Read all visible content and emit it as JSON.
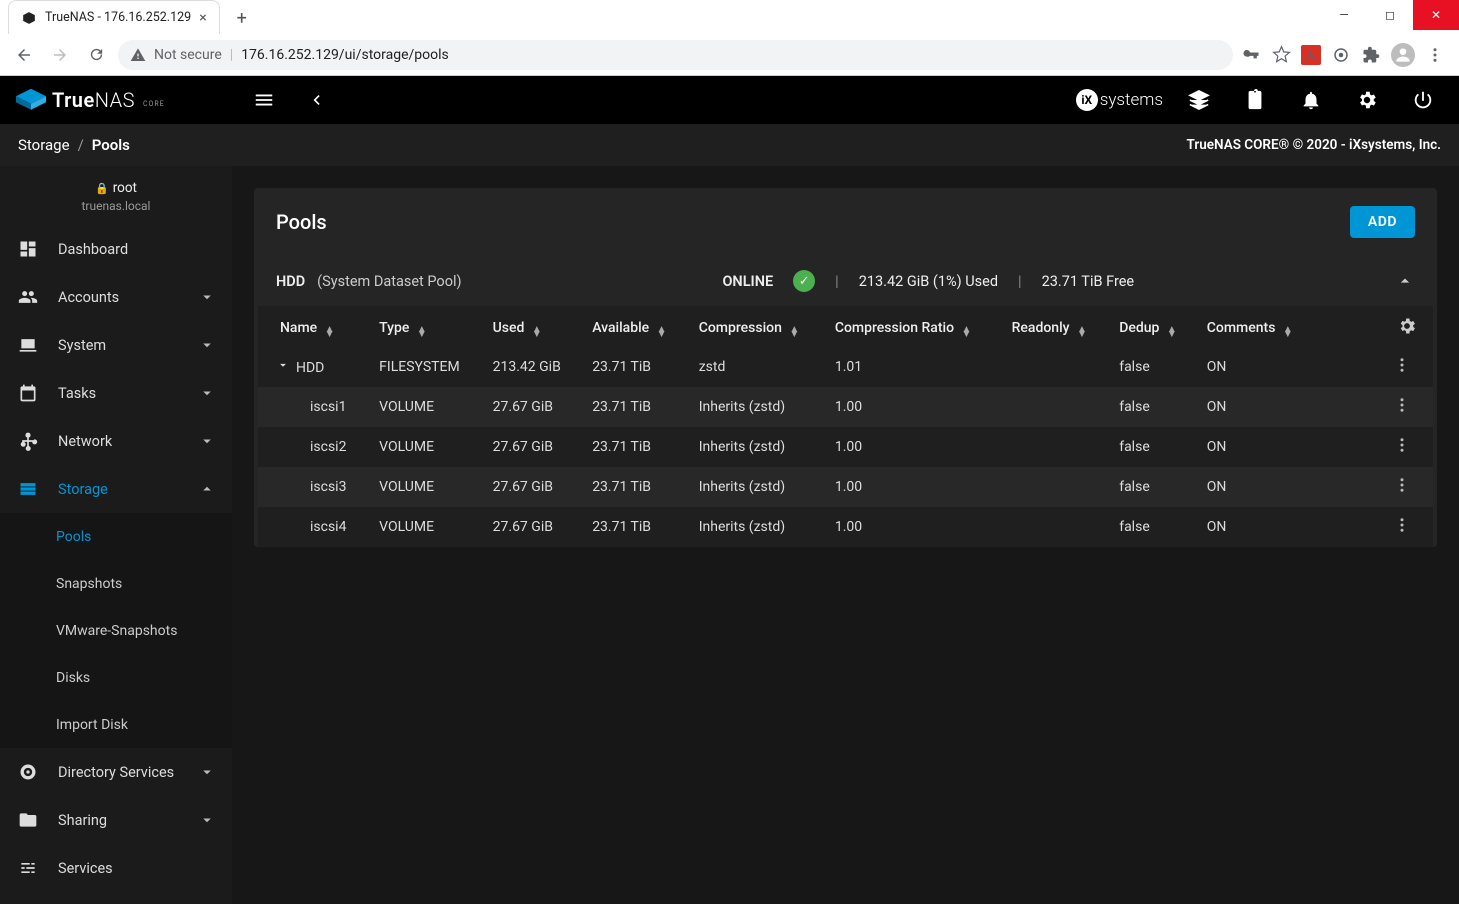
{
  "browser": {
    "tab_title": "TrueNAS - 176.16.252.129",
    "url_insecure_label": "Not secure",
    "url": "176.16.252.129/ui/storage/pools"
  },
  "brand": {
    "name_a": "True",
    "name_b": "NAS",
    "subtitle": "CORE"
  },
  "ix_brand": "systems",
  "breadcrumb": {
    "section": "Storage",
    "page": "Pools"
  },
  "copyright": "TrueNAS CORE® © 2020 - iXsystems, Inc.",
  "user": {
    "name": "root",
    "host": "truenas.local"
  },
  "sidebar": [
    {
      "label": "Dashboard",
      "icon": "dashboard",
      "expandable": false
    },
    {
      "label": "Accounts",
      "icon": "accounts",
      "expandable": true
    },
    {
      "label": "System",
      "icon": "system",
      "expandable": true
    },
    {
      "label": "Tasks",
      "icon": "tasks",
      "expandable": true
    },
    {
      "label": "Network",
      "icon": "network",
      "expandable": true
    },
    {
      "label": "Storage",
      "icon": "storage",
      "expandable": true,
      "active": true,
      "children": [
        {
          "label": "Pools",
          "active": true
        },
        {
          "label": "Snapshots"
        },
        {
          "label": "VMware-Snapshots"
        },
        {
          "label": "Disks"
        },
        {
          "label": "Import Disk"
        }
      ]
    },
    {
      "label": "Directory Services",
      "icon": "directory",
      "expandable": true
    },
    {
      "label": "Sharing",
      "icon": "sharing",
      "expandable": true
    },
    {
      "label": "Services",
      "icon": "services",
      "expandable": false
    }
  ],
  "card": {
    "title": "Pools",
    "add_label": "ADD"
  },
  "pool": {
    "name": "HDD",
    "note": "(System Dataset Pool)",
    "status": "ONLINE",
    "used": "213.42 GiB (1%) Used",
    "free": "23.71 TiB Free"
  },
  "columns": [
    "Name",
    "Type",
    "Used",
    "Available",
    "Compression",
    "Compression Ratio",
    "Readonly",
    "Dedup",
    "Comments"
  ],
  "rows": [
    {
      "indent": 0,
      "expand": true,
      "cells": [
        "HDD",
        "FILESYSTEM",
        "213.42 GiB",
        "23.71 TiB",
        "zstd",
        "1.01",
        "",
        "false",
        "ON",
        ""
      ]
    },
    {
      "indent": 1,
      "alt": true,
      "cells": [
        "iscsi1",
        "VOLUME",
        "27.67 GiB",
        "23.71 TiB",
        "Inherits (zstd)",
        "1.00",
        "",
        "false",
        "ON",
        ""
      ]
    },
    {
      "indent": 1,
      "cells": [
        "iscsi2",
        "VOLUME",
        "27.67 GiB",
        "23.71 TiB",
        "Inherits (zstd)",
        "1.00",
        "",
        "false",
        "ON",
        ""
      ]
    },
    {
      "indent": 1,
      "alt": true,
      "cells": [
        "iscsi3",
        "VOLUME",
        "27.67 GiB",
        "23.71 TiB",
        "Inherits (zstd)",
        "1.00",
        "",
        "false",
        "ON",
        ""
      ]
    },
    {
      "indent": 1,
      "cells": [
        "iscsi4",
        "VOLUME",
        "27.67 GiB",
        "23.71 TiB",
        "Inherits (zstd)",
        "1.00",
        "",
        "false",
        "ON",
        ""
      ]
    }
  ]
}
